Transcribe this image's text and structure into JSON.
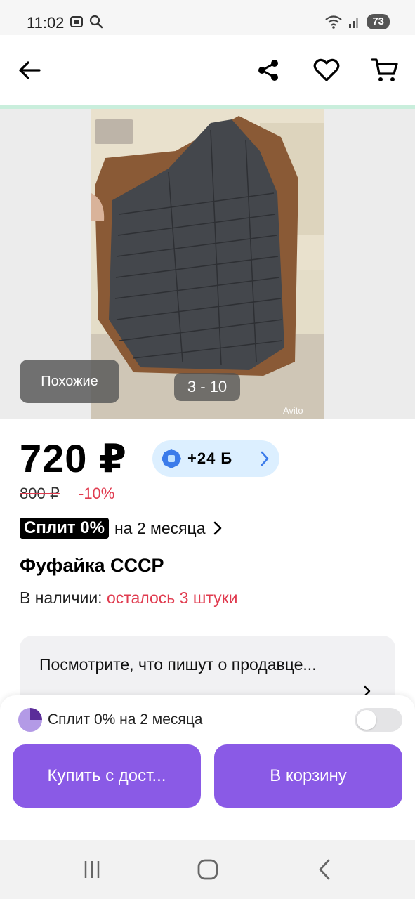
{
  "status_bar": {
    "time": "11:02",
    "battery": "73"
  },
  "gallery": {
    "similar_label": "Похожие",
    "counter": "3 - 10",
    "watermark": "Avito"
  },
  "product": {
    "price": "720 ₽",
    "bonus": "+24 Б",
    "old_price": "800 ₽",
    "discount": "-10%",
    "split_badge": "Сплит 0%",
    "split_text": "на 2 месяца",
    "title": "Фуфайка СССР",
    "stock_label": "В наличии:",
    "stock_left": "осталось 3 штуки"
  },
  "seller_card": {
    "text": "Посмотрите, что пишут о продавце..."
  },
  "bottom_sheet": {
    "split_label": "Сплит 0% на 2 месяца",
    "split_enabled": false,
    "buy_button": "Купить с дост...",
    "cart_button": "В корзину"
  },
  "colors": {
    "accent": "#8a5ae6",
    "discount_red": "#e03b4f",
    "bonus_bg": "#dcefff",
    "bonus_icon": "#3b7bea"
  },
  "icons": [
    "back-arrow-icon",
    "share-icon",
    "heart-icon",
    "cart-icon",
    "chevron-right-icon",
    "recents-icon",
    "home-icon",
    "back-icon"
  ]
}
